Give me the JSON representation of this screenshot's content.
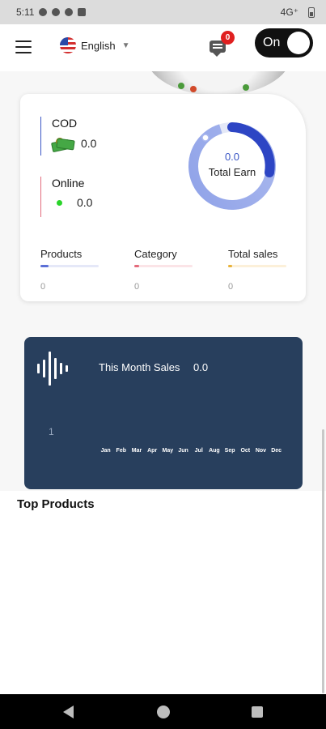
{
  "status_bar": {
    "time": "5:11",
    "network": "4G⁺"
  },
  "header": {
    "language": "English",
    "notification_count": "0",
    "toggle_label": "On"
  },
  "stats": {
    "cod": {
      "label": "COD",
      "value": "0.0"
    },
    "online": {
      "label": "Online",
      "value": "0.0"
    },
    "total_earn": {
      "value": "0.0",
      "label": "Total Earn"
    },
    "metrics": [
      {
        "label": "Products",
        "value": "0",
        "color": "#5b6fd6"
      },
      {
        "label": "Category",
        "value": "0",
        "color": "#e36b7c"
      },
      {
        "label": "Total sales",
        "value": "0",
        "color": "#e8b23a"
      }
    ]
  },
  "sales_panel": {
    "title": "This Month Sales",
    "value": "0.0",
    "y_tick": "1",
    "months": [
      "Jan",
      "Feb",
      "Mar",
      "Apr",
      "May",
      "Jun",
      "Jul",
      "Aug",
      "Sep",
      "Oct",
      "Nov",
      "Dec"
    ]
  },
  "top_products": {
    "title": "Top Products"
  },
  "colors": {
    "accent": "#3a56c5",
    "panel": "#283f5d",
    "badge": "#e02020"
  }
}
